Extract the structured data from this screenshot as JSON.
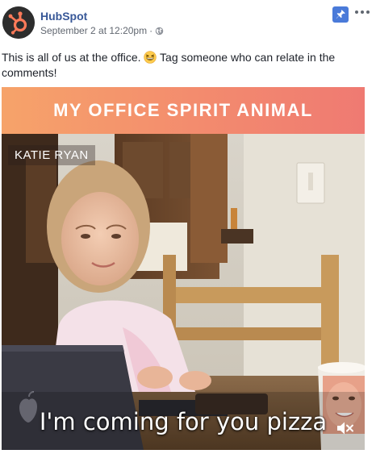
{
  "post": {
    "page_name": "HubSpot",
    "date": "September 2 at 12:20pm",
    "separator": "·",
    "caption_before_emoji": "This is all of us at the office.",
    "caption_emoji": "grinning-squinting-face",
    "caption_after_emoji": "Tag someone who can relate in the comments!"
  },
  "video": {
    "banner_title": "MY OFFICE SPIRIT ANIMAL",
    "name_tag": "KATIE RYAN",
    "subtitle": "I'm coming for you pizza",
    "muted": true
  },
  "icons": {
    "avatar": "hubspot-logo",
    "audience": "globe-icon",
    "pinned": "pin-icon",
    "more": "more-options-icon",
    "sound": "muted-speaker-icon"
  },
  "colors": {
    "page_name": "#385898",
    "pin_badge": "#4a7ad9",
    "banner_start": "#f6a36a",
    "banner_end": "#ef7a72"
  }
}
